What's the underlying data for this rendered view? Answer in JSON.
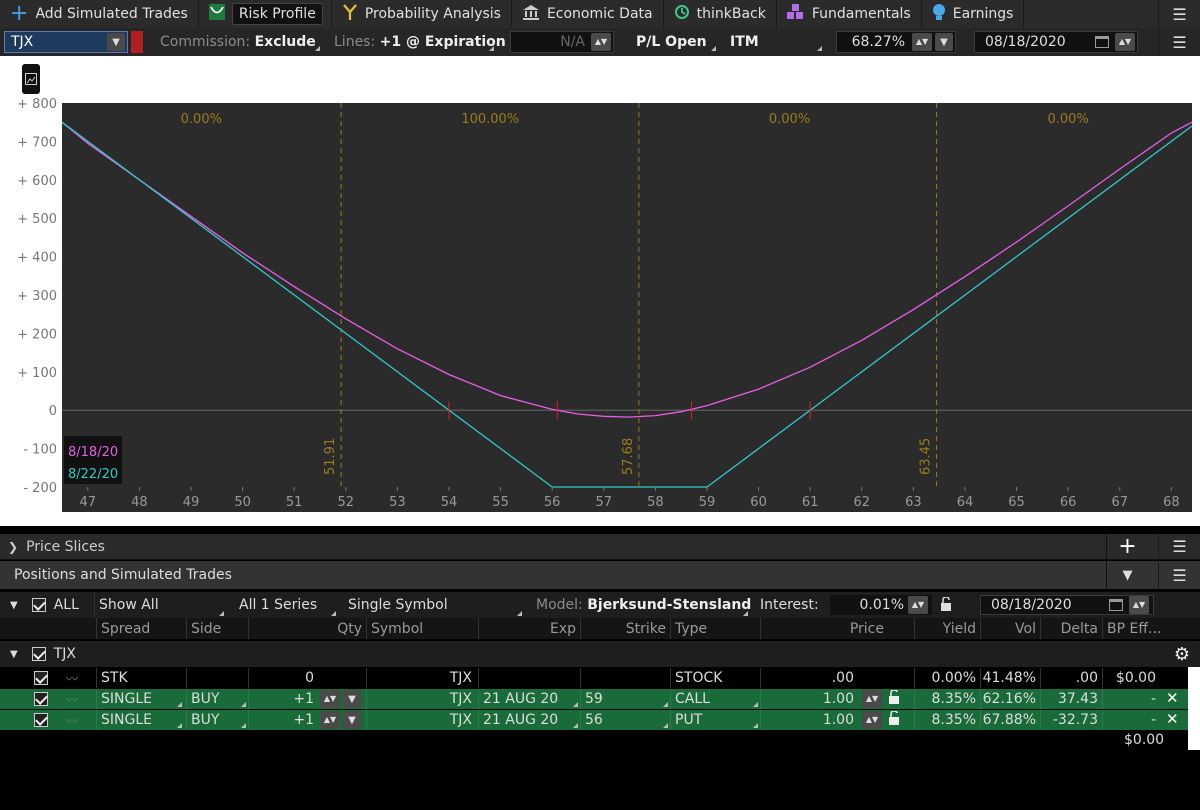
{
  "tabs": [
    {
      "label": "Add Simulated Trades",
      "icon": "plus-icon"
    },
    {
      "label": "Risk Profile",
      "icon": "risk-profile-icon",
      "active": true
    },
    {
      "label": "Probability Analysis",
      "icon": "probability-icon"
    },
    {
      "label": "Economic Data",
      "icon": "bank-icon"
    },
    {
      "label": "thinkBack",
      "icon": "history-icon"
    },
    {
      "label": "Fundamentals",
      "icon": "blocks-icon"
    },
    {
      "label": "Earnings",
      "icon": "bulb-icon"
    }
  ],
  "controls": {
    "symbol": "TJX",
    "commission_label": "Commission:",
    "commission_value": "Exclude",
    "lines_label": "Lines:",
    "lines_value": "+1 @ Expiration",
    "na_value": "N/A",
    "pl_mode": "P/L Open",
    "itm": "ITM",
    "probability": "68.27%",
    "date": "08/18/2020"
  },
  "chart_data": {
    "type": "line",
    "xlim": [
      46.5,
      68.4
    ],
    "ylim": [
      -200,
      800
    ],
    "xticks": [
      47,
      48,
      49,
      50,
      51,
      52,
      53,
      54,
      55,
      56,
      57,
      58,
      59,
      60,
      61,
      62,
      63,
      64,
      65,
      66,
      67,
      68
    ],
    "yticks": [
      {
        "v": 800,
        "label": "+ 800"
      },
      {
        "v": 700,
        "label": "+ 700"
      },
      {
        "v": 600,
        "label": "+ 600"
      },
      {
        "v": 500,
        "label": "+ 500"
      },
      {
        "v": 400,
        "label": "+ 400"
      },
      {
        "v": 300,
        "label": "+ 300"
      },
      {
        "v": 200,
        "label": "+ 200"
      },
      {
        "v": 100,
        "label": "+ 100"
      },
      {
        "v": 0,
        "label": "0"
      },
      {
        "v": -100,
        "label": "- 100"
      },
      {
        "v": -200,
        "label": "- 200"
      }
    ],
    "vlines": [
      {
        "x": 51.91,
        "label": "51.91"
      },
      {
        "x": 57.68,
        "label": "57.68"
      },
      {
        "x": 63.45,
        "label": "63.45"
      }
    ],
    "region_probs": [
      {
        "x": 49.2,
        "label": "0.00%"
      },
      {
        "x": 54.8,
        "label": "100.00%"
      },
      {
        "x": 60.6,
        "label": "0.00%"
      },
      {
        "x": 66.0,
        "label": "0.00%"
      }
    ],
    "series": [
      {
        "name": "8/18/20",
        "color": "#e85de8",
        "x": [
          46.5,
          47,
          48,
          49,
          50,
          51,
          52,
          53,
          54,
          55,
          56,
          56.5,
          57,
          57.5,
          58,
          58.5,
          59,
          60,
          61,
          62,
          63,
          64,
          65,
          66,
          67,
          68,
          68.4
        ],
        "y": [
          750,
          695,
          600,
          505,
          410,
          322,
          238,
          160,
          93,
          38,
          2,
          -10,
          -16,
          -18,
          -14,
          -4,
          12,
          55,
          112,
          182,
          262,
          348,
          438,
          532,
          628,
          722,
          750
        ]
      },
      {
        "name": "8/22/20",
        "color": "#30c8c8",
        "x": [
          46.5,
          56,
          59,
          68.4
        ],
        "y": [
          750,
          -200,
          -200,
          740
        ]
      }
    ],
    "markers": [
      54,
      56.1,
      58.7,
      61
    ]
  },
  "panels": {
    "price_slices": "Price Slices",
    "positions": "Positions and Simulated Trades"
  },
  "filters": {
    "all_label": "ALL",
    "show_all": "Show All",
    "series": "All 1 Series",
    "symbol_mode": "Single Symbol",
    "model_label": "Model:",
    "model_value": "Bjerksund-Stensland",
    "interest_label": "Interest:",
    "interest_value": "0.01%",
    "date": "08/18/2020"
  },
  "columns": [
    "Spread",
    "Side",
    "Qty",
    "Symbol",
    "Exp",
    "Strike",
    "Type",
    "Price",
    "Yield",
    "Vol",
    "Delta",
    "BP Eff..."
  ],
  "group": "TJX",
  "rows": [
    {
      "spread": "STK",
      "side": "",
      "qty": "0",
      "symbol": "TJX",
      "exp": "",
      "strike": "",
      "type": "STOCK",
      "price": ".00",
      "yield": "0.00%",
      "vol": "41.48%",
      "delta": ".00",
      "bp": "$0.00",
      "green": false
    },
    {
      "spread": "SINGLE",
      "side": "BUY",
      "qty": "+1",
      "symbol": "TJX",
      "exp": "21 AUG 20",
      "strike": "59",
      "type": "CALL",
      "price": "1.00",
      "yield": "8.35%",
      "vol": "62.16%",
      "delta": "37.43",
      "bp": "-",
      "green": true
    },
    {
      "spread": "SINGLE",
      "side": "BUY",
      "qty": "+1",
      "symbol": "TJX",
      "exp": "21 AUG 20",
      "strike": "56",
      "type": "PUT",
      "price": "1.00",
      "yield": "8.35%",
      "vol": "67.88%",
      "delta": "-32.73",
      "bp": "-",
      "green": true
    }
  ],
  "total": "$0.00"
}
